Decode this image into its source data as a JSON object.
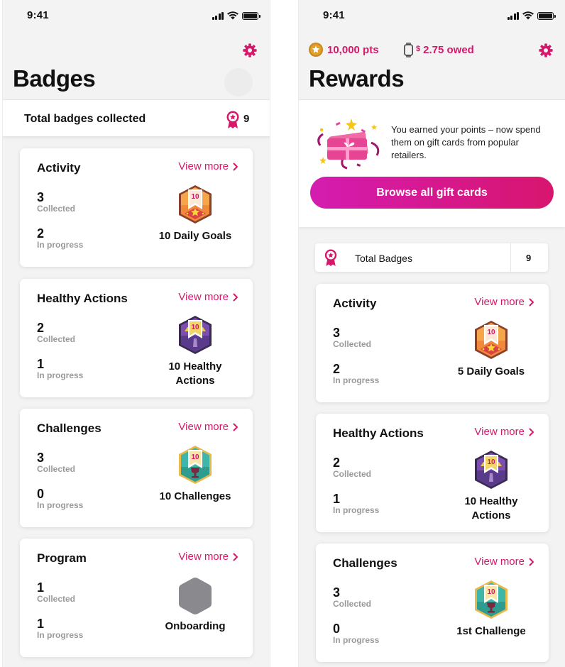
{
  "colors": {
    "accent": "#d6186a",
    "button_start": "#d41cb1",
    "button_end": "#d8156e",
    "label_gray": "#9a9a9a",
    "background": "#f3f3f3"
  },
  "left": {
    "status_time": "9:41",
    "title": "Badges",
    "total": {
      "label": "Total badges collected",
      "count": "9"
    },
    "cards": [
      {
        "title": "Activity",
        "view_more": "View more",
        "collected": "3",
        "collected_label": "Collected",
        "in_progress": "2",
        "in_progress_label": "In progress",
        "badge_name": "10 Daily Goals",
        "badge_icon": "activity-badge-icon"
      },
      {
        "title": "Healthy Actions",
        "view_more": "View more",
        "collected": "2",
        "collected_label": "Collected",
        "in_progress": "1",
        "in_progress_label": "In progress",
        "badge_name_line1": "10 Healthy",
        "badge_name_line2": "Actions",
        "badge_icon": "healthy-actions-badge-icon"
      },
      {
        "title": "Challenges",
        "view_more": "View more",
        "collected": "3",
        "collected_label": "Collected",
        "in_progress": "0",
        "in_progress_label": "In progress",
        "badge_name": "10 Challenges",
        "badge_icon": "challenge-badge-icon"
      },
      {
        "title": "Program",
        "view_more": "View more",
        "collected": "1",
        "collected_label": "Collected",
        "in_progress": "1",
        "in_progress_label": "In progress",
        "badge_name": "Onboarding",
        "badge_icon": "locked-badge-icon"
      }
    ]
  },
  "right": {
    "status_time": "9:41",
    "points": "10,000 pts",
    "owed_currency": "$",
    "owed": "2.75 owed",
    "title": "Rewards",
    "promo_text": "You earned your points – now spend them on gift cards from  popular retailers.",
    "browse_button": "Browse all gift cards",
    "total_badges": {
      "label": "Total Badges",
      "count": "9"
    },
    "cards": [
      {
        "title": "Activity",
        "view_more": "View more",
        "collected": "3",
        "collected_label": "Collected",
        "in_progress": "2",
        "in_progress_label": "In progress",
        "badge_name": "5 Daily Goals",
        "badge_icon": "activity-badge-icon"
      },
      {
        "title": "Healthy Actions",
        "view_more": "View more",
        "collected": "2",
        "collected_label": "Collected",
        "in_progress": "1",
        "in_progress_label": "In progress",
        "badge_name_line1": "10 Healthy",
        "badge_name_line2": "Actions",
        "badge_icon": "healthy-actions-badge-icon"
      },
      {
        "title": "Challenges",
        "view_more": "View more",
        "collected": "3",
        "collected_label": "Collected",
        "in_progress": "0",
        "in_progress_label": "In progress",
        "badge_name": "1st Challenge",
        "badge_icon": "challenge-badge-icon"
      }
    ]
  }
}
